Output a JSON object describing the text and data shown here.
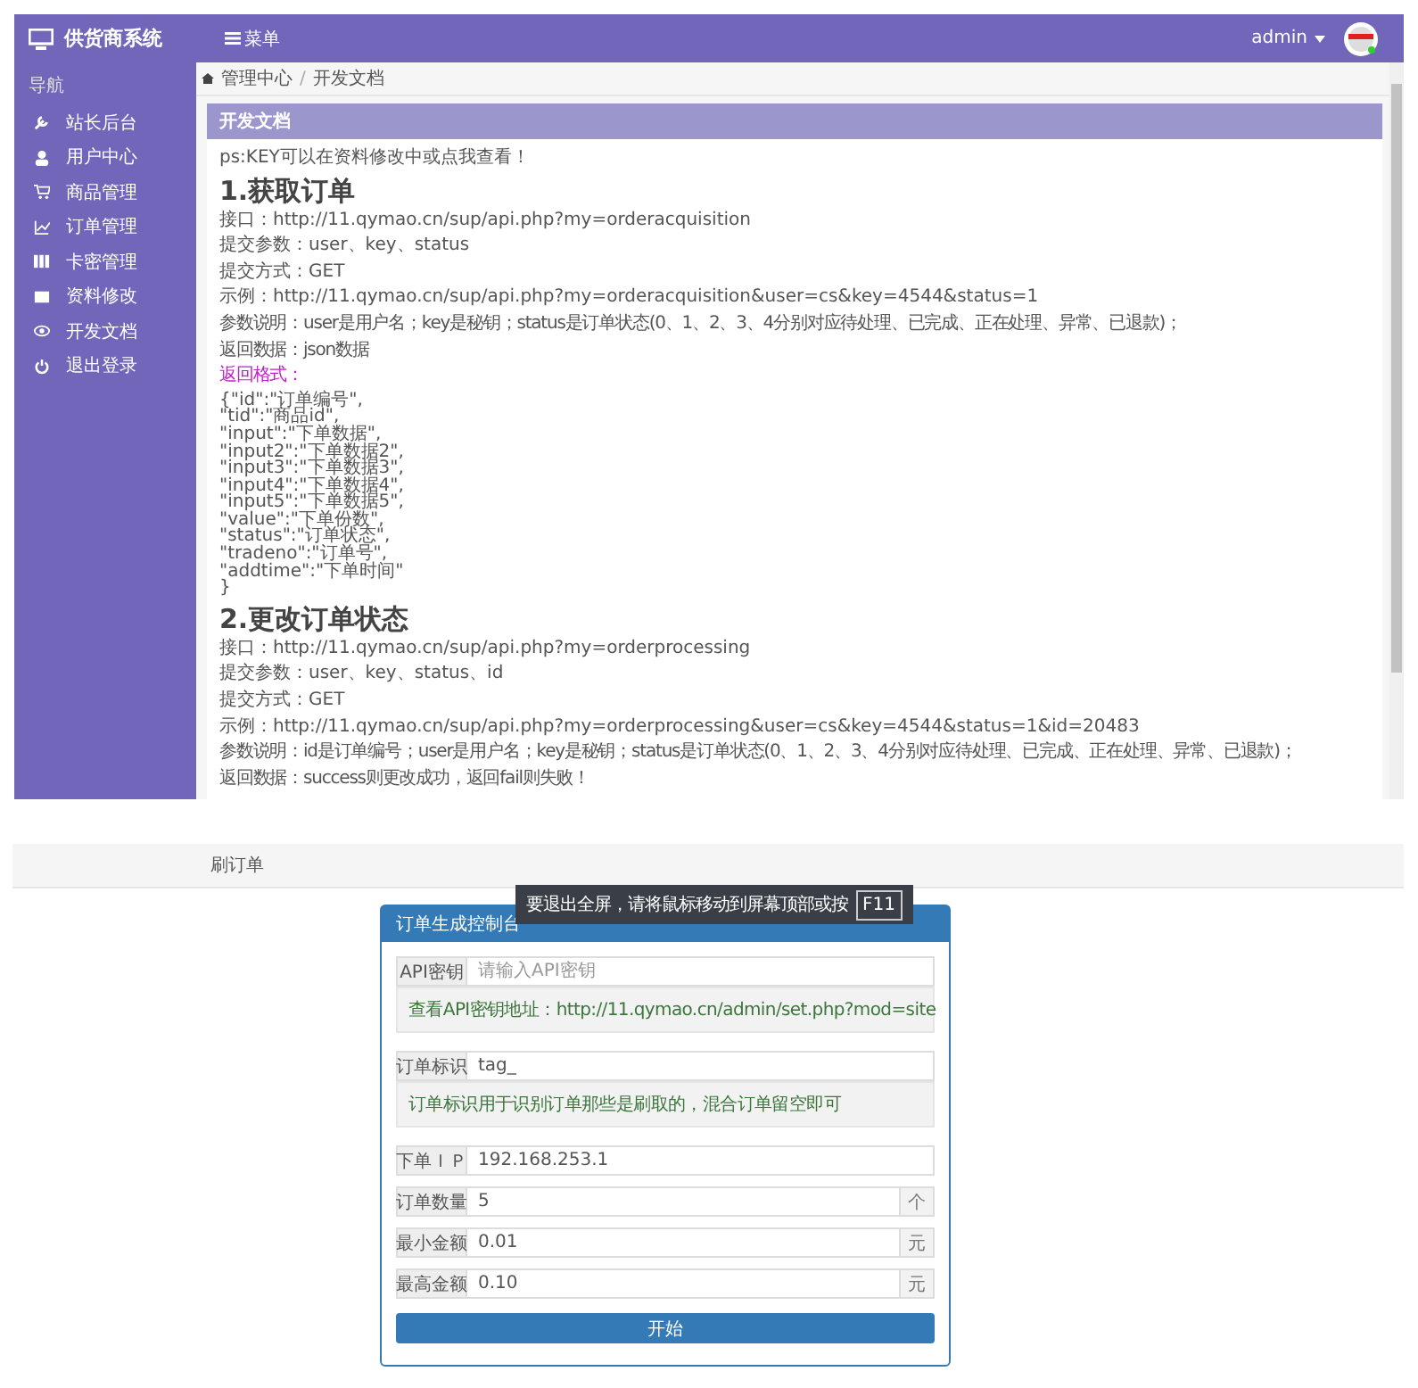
{
  "admin_screen": {
    "brand": "供货商系统",
    "menu_label": "菜单",
    "user": "admin",
    "sidebar": {
      "heading": "导航",
      "items": [
        {
          "label": "站长后台"
        },
        {
          "label": "用户中心"
        },
        {
          "label": "商品管理"
        },
        {
          "label": "订单管理"
        },
        {
          "label": "卡密管理"
        },
        {
          "label": "资料修改"
        },
        {
          "label": "开发文档"
        },
        {
          "label": "退出登录"
        }
      ]
    },
    "breadcrumb": {
      "items": [
        "管理中心",
        "开发文档"
      ],
      "separator": "/"
    },
    "doc": {
      "title": "开发文档",
      "blocks": [
        {
          "kind": "text",
          "text": "ps:KEY可以在资料修改中或点我查看！"
        },
        {
          "kind": "heading",
          "text": "1.获取订单"
        },
        {
          "kind": "text",
          "text": "接口：http://11.qymao.cn/sup/api.php?my=orderacquisition"
        },
        {
          "kind": "text",
          "text": "提交参数：user、key、status"
        },
        {
          "kind": "text",
          "text": "提交方式：GET"
        },
        {
          "kind": "text",
          "text": "示例：http://11.qymao.cn/sup/api.php?my=orderacquisition&user=cs&key=4544&status=1"
        },
        {
          "kind": "small",
          "text": "参数说明：user是用户名；key是秘钥；status是订单状态(0、1、2、3、4分别对应待处理、已完成、正在处理、异常、已退款)；"
        },
        {
          "kind": "small",
          "text": "返回数据：json数据"
        },
        {
          "kind": "label",
          "text": "返回格式："
        },
        {
          "kind": "code",
          "lines": [
            "{\"id\":\"订单编号\",",
            "\"tid\":\"商品id\",",
            "\"input\":\"下单数据\",",
            "\"input2\":\"下单数据2\",",
            "\"input3\":\"下单数据3\",",
            "\"input4\":\"下单数据4\",",
            "\"input5\":\"下单数据5\",",
            "\"value\":\"下单份数\",",
            "\"status\":\"订单状态\",",
            "\"tradeno\":\"订单号\",",
            "\"addtime\":\"下单时间\"",
            "}"
          ]
        },
        {
          "kind": "heading",
          "text": "2.更改订单状态"
        },
        {
          "kind": "text",
          "text": "接口：http://11.qymao.cn/sup/api.php?my=orderprocessing"
        },
        {
          "kind": "text",
          "text": "提交参数：user、key、status、id"
        },
        {
          "kind": "text",
          "text": "提交方式：GET"
        },
        {
          "kind": "text",
          "text": "示例：http://11.qymao.cn/sup/api.php?my=orderprocessing&user=cs&key=4544&status=1&id=20483"
        },
        {
          "kind": "small",
          "text": "参数说明：id是订单编号；user是用户名；key是秘钥；status是订单状态(0、1、2、3、4分别对应待处理、已完成、正在处理、异常、已退款)；"
        },
        {
          "kind": "small",
          "text": "返回数据：success则更改成功，返回fail则失败！"
        }
      ]
    }
  },
  "order_screen": {
    "page_title": "刷订单",
    "toast": {
      "text": "要退出全屏，请将鼠标移动到屏幕顶部或按",
      "key": "F11"
    },
    "panel": {
      "title": "订单生成控制台",
      "rows": [
        {
          "kind": "input",
          "label": "API密钥",
          "placeholder": "请输入API密钥"
        },
        {
          "kind": "help",
          "text": "查看API密钥地址：http://11.qymao.cn/admin/set.php?mod=site"
        },
        {
          "kind": "input",
          "label": "订单标识",
          "value": "tag_"
        },
        {
          "kind": "help",
          "text": "订单标识用于识别订单那些是刷取的，混合订单留空即可"
        },
        {
          "kind": "input",
          "label": "下单ＩＰ",
          "value": "192.168.253.1"
        },
        {
          "kind": "input",
          "label": "订单数量",
          "value": "5",
          "addon": "个"
        },
        {
          "kind": "input",
          "label": "最小金额",
          "value": "0.01",
          "addon": "元"
        },
        {
          "kind": "input",
          "label": "最高金额",
          "value": "0.10",
          "addon": "元"
        }
      ],
      "button": "开始"
    }
  }
}
